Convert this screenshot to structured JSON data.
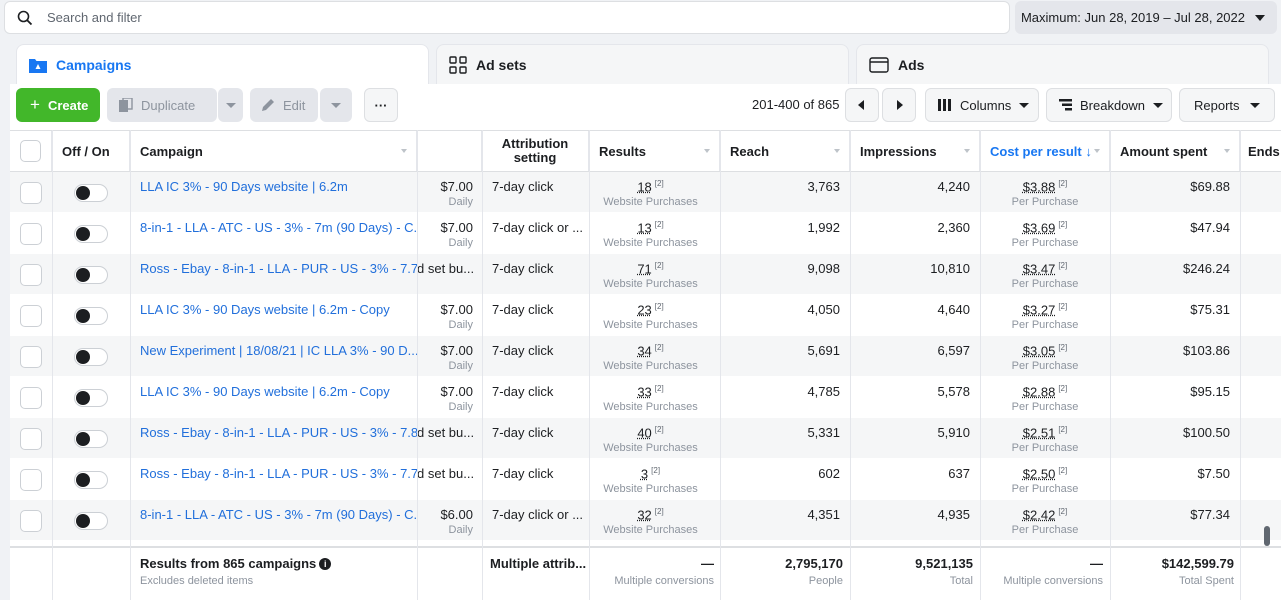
{
  "search": {
    "placeholder": "Search and filter"
  },
  "date_range": {
    "label": "Maximum: Jun 28, 2019 – Jul 28, 2022"
  },
  "tabs": [
    {
      "label": "Campaigns",
      "icon": "campaigns-icon",
      "active": true
    },
    {
      "label": "Ad sets",
      "icon": "ad-sets-icon",
      "active": false
    },
    {
      "label": "Ads",
      "icon": "ads-icon",
      "active": false
    }
  ],
  "toolbar": {
    "create_label": "Create",
    "duplicate_label": "Duplicate",
    "edit_label": "Edit",
    "more_label": "···",
    "pager_label": "201-400 of 865",
    "columns_label": "Columns",
    "breakdown_label": "Breakdown",
    "reports_label": "Reports"
  },
  "columns": {
    "off_on": "Off / On",
    "campaign": "Campaign",
    "attribution": "Attribution setting",
    "results": "Results",
    "reach": "Reach",
    "impressions": "Impressions",
    "cost_per_result": "Cost per result ↓",
    "amount_spent": "Amount spent",
    "ends": "Ends"
  },
  "rows": [
    {
      "campaign": "LLA IC 3% - 90 Days website | 6.2m",
      "budget": "$7.00",
      "budget_sub": "Daily",
      "attribution": "7-day click",
      "results": "18",
      "results_sub": "Website Purchases",
      "reach": "3,763",
      "impressions": "4,240",
      "cpr": "$3.88",
      "cpr_sub": "Per Purchase",
      "spent": "$69.88"
    },
    {
      "campaign": "8-in-1 - LLA - ATC - US - 3% - 7m (90 Days) - C...",
      "budget": "$7.00",
      "budget_sub": "Daily",
      "attribution": "7-day click or ...",
      "results": "13",
      "results_sub": "Website Purchases",
      "reach": "1,992",
      "impressions": "2,360",
      "cpr": "$3.69",
      "cpr_sub": "Per Purchase",
      "spent": "$47.94"
    },
    {
      "campaign": "Ross - Ebay - 8-in-1 - LLA - PUR - US - 3% - 7.7...",
      "budget": "d set bu...",
      "budget_sub": "",
      "attribution": "7-day click",
      "results": "71",
      "results_sub": "Website Purchases",
      "reach": "9,098",
      "impressions": "10,810",
      "cpr": "$3.47",
      "cpr_sub": "Per Purchase",
      "spent": "$246.24"
    },
    {
      "campaign": "LLA IC 3% - 90 Days website | 6.2m - Copy",
      "budget": "$7.00",
      "budget_sub": "Daily",
      "attribution": "7-day click",
      "results": "23",
      "results_sub": "Website Purchases",
      "reach": "4,050",
      "impressions": "4,640",
      "cpr": "$3.27",
      "cpr_sub": "Per Purchase",
      "spent": "$75.31"
    },
    {
      "campaign": "New Experiment | 18/08/21 | IC LLA 3% - 90 D...",
      "budget": "$7.00",
      "budget_sub": "Daily",
      "attribution": "7-day click",
      "results": "34",
      "results_sub": "Website Purchases",
      "reach": "5,691",
      "impressions": "6,597",
      "cpr": "$3.05",
      "cpr_sub": "Per Purchase",
      "spent": "$103.86"
    },
    {
      "campaign": "LLA IC 3% - 90 Days website | 6.2m - Copy",
      "budget": "$7.00",
      "budget_sub": "Daily",
      "attribution": "7-day click",
      "results": "33",
      "results_sub": "Website Purchases",
      "reach": "4,785",
      "impressions": "5,578",
      "cpr": "$2.88",
      "cpr_sub": "Per Purchase",
      "spent": "$95.15"
    },
    {
      "campaign": "Ross - Ebay - 8-in-1 - LLA - PUR - US - 3% - 7.8...",
      "budget": "d set bu...",
      "budget_sub": "",
      "attribution": "7-day click",
      "results": "40",
      "results_sub": "Website Purchases",
      "reach": "5,331",
      "impressions": "5,910",
      "cpr": "$2.51",
      "cpr_sub": "Per Purchase",
      "spent": "$100.50"
    },
    {
      "campaign": "Ross - Ebay - 8-in-1 - LLA - PUR - US - 3% - 7.7...",
      "budget": "d set bu...",
      "budget_sub": "",
      "attribution": "7-day click",
      "results": "3",
      "results_sub": "Website Purchases",
      "reach": "602",
      "impressions": "637",
      "cpr": "$2.50",
      "cpr_sub": "Per Purchase",
      "spent": "$7.50"
    },
    {
      "campaign": "8-in-1 - LLA - ATC - US - 3% - 7m (90 Days) - C...",
      "budget": "$6.00",
      "budget_sub": "Daily",
      "attribution": "7-day click or ...",
      "results": "32",
      "results_sub": "Website Purchases",
      "reach": "4,351",
      "impressions": "4,935",
      "cpr": "$2.42",
      "cpr_sub": "Per Purchase",
      "spent": "$77.34"
    }
  ],
  "summary": {
    "title": "Results from 865 campaigns",
    "subtitle": "Excludes deleted items",
    "attribution": "Multiple attrib...",
    "results": "—",
    "results_sub": "Multiple conversions",
    "reach": "2,795,170",
    "reach_sub": "People",
    "impressions": "9,521,135",
    "impressions_sub": "Total",
    "cpr": "—",
    "cpr_sub": "Multiple conversions",
    "spent": "$142,599.79",
    "spent_sub": "Total Spent"
  },
  "colors": {
    "accent": "#1877f2",
    "create": "#42b72a"
  }
}
